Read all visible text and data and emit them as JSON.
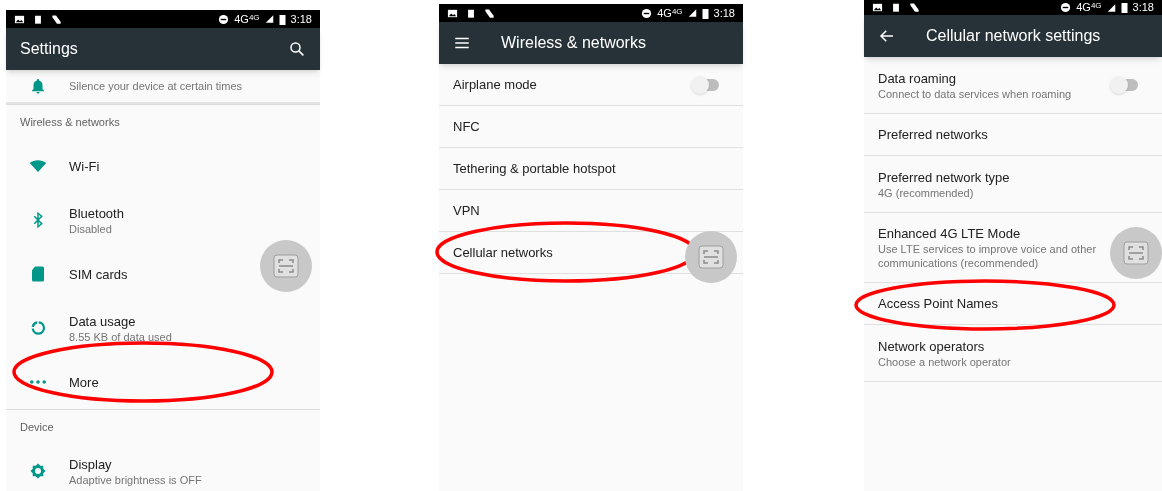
{
  "screens": [
    {
      "status_bar": {
        "network": "4G",
        "network_badge": "4G",
        "time": "3:18"
      },
      "app_bar": {
        "title": "Settings"
      },
      "rows": [
        {
          "kind": "partial",
          "subtitle": "Silence your device at certain times"
        },
        {
          "kind": "header",
          "title": "Wireless & networks"
        },
        {
          "kind": "entry",
          "title": "Wi-Fi",
          "circled": false
        },
        {
          "kind": "entry",
          "title": "Bluetooth",
          "subtitle": "Disabled",
          "circled": false
        },
        {
          "kind": "entry",
          "title": "SIM cards",
          "circled": false
        },
        {
          "kind": "entry",
          "title": "Data usage",
          "subtitle": "8.55 KB of data used",
          "circled": false
        },
        {
          "kind": "entry",
          "title": "More",
          "circled": true
        },
        {
          "kind": "header",
          "title": "Device"
        },
        {
          "kind": "entry",
          "title": "Display",
          "subtitle": "Adaptive brightness is OFF",
          "circled": false
        }
      ]
    },
    {
      "status_bar": {
        "network": "4G",
        "network_badge": "4G",
        "time": "3:18"
      },
      "app_bar": {
        "title": "Wireless & networks"
      },
      "rows": [
        {
          "kind": "toggle",
          "title": "Airplane mode",
          "on": false,
          "circled": false
        },
        {
          "kind": "entry",
          "title": "NFC",
          "circled": false
        },
        {
          "kind": "entry",
          "title": "Tethering & portable hotspot",
          "circled": false
        },
        {
          "kind": "entry",
          "title": "VPN",
          "circled": false
        },
        {
          "kind": "entry",
          "title": "Cellular networks",
          "circled": true
        }
      ]
    },
    {
      "status_bar": {
        "network": "4G",
        "network_badge": "4G",
        "time": "3:18"
      },
      "app_bar": {
        "title": "Cellular network settings"
      },
      "rows": [
        {
          "kind": "toggle",
          "title": "Data roaming",
          "subtitle": "Connect to data services when roaming",
          "on": false,
          "circled": false
        },
        {
          "kind": "entry",
          "title": "Preferred networks",
          "circled": false
        },
        {
          "kind": "entry",
          "title": "Preferred network type",
          "subtitle": "4G (recommended)",
          "circled": false
        },
        {
          "kind": "entry",
          "title": "Enhanced 4G LTE Mode",
          "subtitle": "Use LTE services to improve voice and other communications (recommended)",
          "circled": false
        },
        {
          "kind": "entry",
          "title": "Access Point Names",
          "circled": true
        },
        {
          "kind": "entry",
          "title": "Network operators",
          "subtitle": "Choose a network operator",
          "circled": false
        }
      ]
    }
  ]
}
